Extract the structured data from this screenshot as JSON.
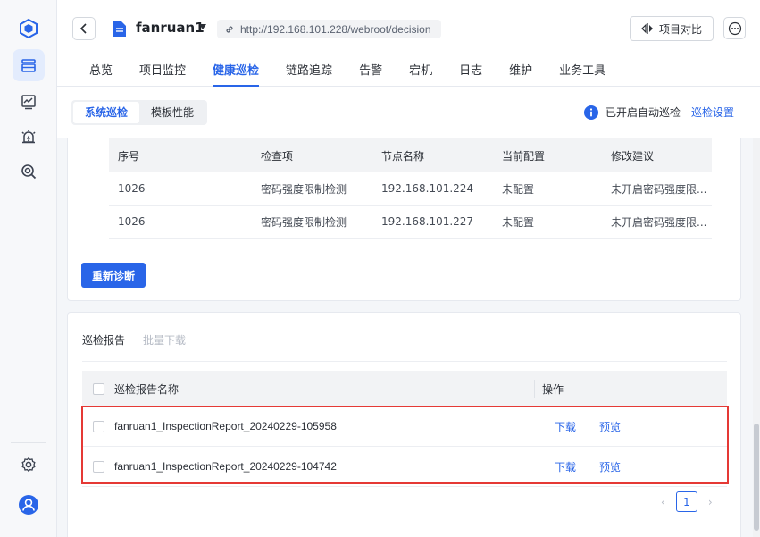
{
  "header": {
    "project_name": "fanruan1",
    "url": "http://192.168.101.228/webroot/decision",
    "compare_label": "项目对比"
  },
  "tabs": [
    {
      "label": "总览",
      "active": false
    },
    {
      "label": "项目监控",
      "active": false
    },
    {
      "label": "健康巡检",
      "active": true
    },
    {
      "label": "链路追踪",
      "active": false
    },
    {
      "label": "告警",
      "active": false
    },
    {
      "label": "宕机",
      "active": false
    },
    {
      "label": "日志",
      "active": false
    },
    {
      "label": "维护",
      "active": false
    },
    {
      "label": "业务工具",
      "active": false
    }
  ],
  "subtabs": {
    "system": "系统巡检",
    "template": "模板性能",
    "auto_status": "已开启自动巡检",
    "settings_link": "巡检设置"
  },
  "check_table": {
    "headers": [
      "序号",
      "检查项",
      "节点名称",
      "当前配置",
      "修改建议"
    ],
    "rows": [
      [
        "1026",
        "密码强度限制检测",
        "192.168.101.224",
        "未配置",
        "未开启密码强度限..."
      ],
      [
        "1026",
        "密码强度限制检测",
        "192.168.101.227",
        "未配置",
        "未开启密码强度限..."
      ]
    ],
    "rediagnose_label": "重新诊断"
  },
  "reports": {
    "tab_reports": "巡检报告",
    "tab_batch_download": "批量下载",
    "headers": {
      "name": "巡检报告名称",
      "actions": "操作"
    },
    "rows": [
      {
        "name": "fanruan1_InspectionReport_20240229-105958",
        "download": "下载",
        "preview": "预览"
      },
      {
        "name": "fanruan1_InspectionReport_20240229-104742",
        "download": "下载",
        "preview": "预览"
      }
    ],
    "page": "1"
  },
  "colors": {
    "accent": "#2965e8",
    "highlight_box": "#e53935"
  },
  "icons": [
    "logo-icon",
    "dashboard-icon",
    "chart-icon",
    "alarm-icon",
    "monitor-search-icon",
    "settings-icon",
    "user-avatar-icon",
    "back-arrow-icon",
    "project-file-icon",
    "link-icon",
    "compare-icon",
    "more-icon",
    "info-icon"
  ]
}
